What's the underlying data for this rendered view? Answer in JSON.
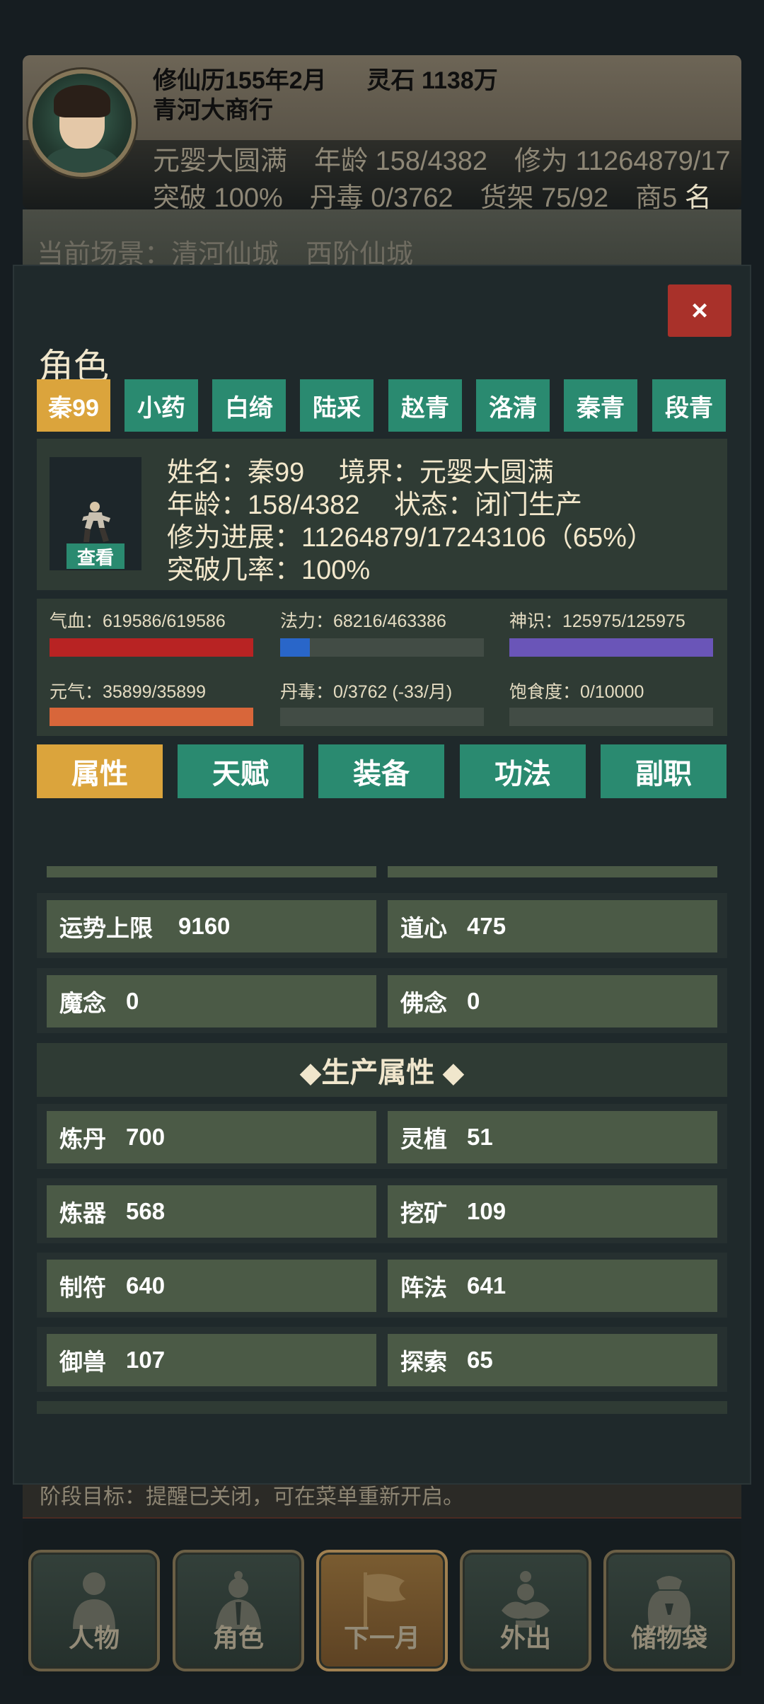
{
  "header": {
    "date_label": "修仙历155年2月",
    "spirit_stone_label": "灵石 1138万",
    "shop_name": "青河大商行",
    "stats_line1": "元婴大圆满　年龄 158/4382　修为 11264879/17",
    "stats_line2_dim": "突破 100%　丹毒 0/3762　货架 75/92　商5",
    "stats_line2_bright": "名",
    "scene": "当前场景：清河仙城　西阶仙城"
  },
  "modal": {
    "close_label": "×",
    "title": "角色",
    "characters": [
      "秦99",
      "小药",
      "白绮",
      "陆采",
      "赵青",
      "洛清",
      "秦青",
      "段青"
    ],
    "active_character_index": 0,
    "view_label": "查看",
    "info": {
      "line1": "姓名：秦99　 境界：元婴大圆满",
      "line2": "年龄：158/4382　 状态：闭门生产",
      "line3": "修为进展：11264879/17243106（65%）",
      "line4": "突破几率：100%"
    },
    "stats": [
      {
        "label": "气血：619586/619586",
        "fraction": 1.0,
        "color": "#b82323"
      },
      {
        "label": "法力：68216/463386",
        "fraction": 0.147,
        "color": "#2966c9"
      },
      {
        "label": "神识：125975/125975",
        "fraction": 1.0,
        "color": "#6a55b8"
      },
      {
        "label": "元气：35899/35899",
        "fraction": 1.0,
        "color": "#d8663a"
      },
      {
        "label": "丹毒：0/3762 (-33/月)",
        "fraction": 0.0,
        "color": "#5a8a3a"
      },
      {
        "label": "饱食度：0/10000",
        "fraction": 0.0,
        "color": "#c7a13a"
      }
    ],
    "sub_tabs": [
      "属性",
      "天赋",
      "装备",
      "功法",
      "副职"
    ],
    "active_sub_tab_index": 0,
    "attributes": {
      "fortune_cap_label": "运势上限",
      "fortune_cap_value": "9160",
      "dao_heart_label": "道心",
      "dao_heart_value": "475",
      "demon_thought_label": "魔念",
      "demon_thought_value": "0",
      "buddha_thought_label": "佛念",
      "buddha_thought_value": "0"
    },
    "production_header": "◆生产属性 ◆",
    "production": {
      "alchemy_label": "炼丹",
      "alchemy_value": "700",
      "herb_label": "灵植",
      "herb_value": "51",
      "forging_label": "炼器",
      "forging_value": "568",
      "mining_label": "挖矿",
      "mining_value": "109",
      "talisman_label": "制符",
      "talisman_value": "640",
      "formation_label": "阵法",
      "formation_value": "641",
      "beast_label": "御兽",
      "beast_value": "107",
      "explore_label": "探索",
      "explore_value": "65"
    }
  },
  "goal_text": "阶段目标：提醒已关闭，可在菜单重新开启。",
  "bottom_nav": [
    "人物",
    "角色",
    "下一月",
    "外出",
    "储物袋"
  ]
}
